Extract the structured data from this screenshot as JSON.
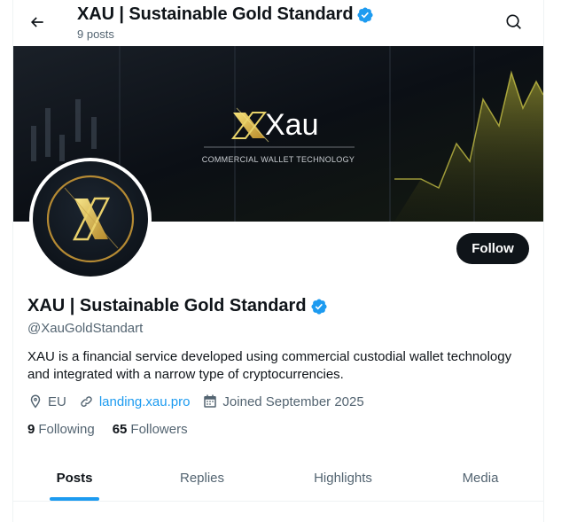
{
  "header": {
    "title": "XAU | Sustainable Gold Standard",
    "post_count": "9 posts",
    "back_icon": "arrow-left-icon",
    "search_icon": "search-icon"
  },
  "banner": {
    "logo_text": "Xau",
    "tagline": "COMMERCIAL WALLET TECHNOLOGY"
  },
  "profile": {
    "name": "XAU | Sustainable Gold Standard",
    "handle": "@XauGoldStandart",
    "bio": "XAU is a financial service developed using commercial custodial wallet technology and integrated with a narrow type of cryptocurrencies.",
    "location": "EU",
    "website": "landing.xau.pro",
    "joined": "Joined September 2025",
    "following_count": "9",
    "following_label": "Following",
    "followers_count": "65",
    "followers_label": "Followers",
    "follow_label": "Follow"
  },
  "tabs": [
    {
      "label": "Posts",
      "active": true
    },
    {
      "label": "Replies",
      "active": false
    },
    {
      "label": "Highlights",
      "active": false
    },
    {
      "label": "Media",
      "active": false
    }
  ],
  "colors": {
    "accent": "#1d9bf0",
    "text": "#0f1419",
    "muted": "#536471",
    "gold": "#d9b44a"
  }
}
